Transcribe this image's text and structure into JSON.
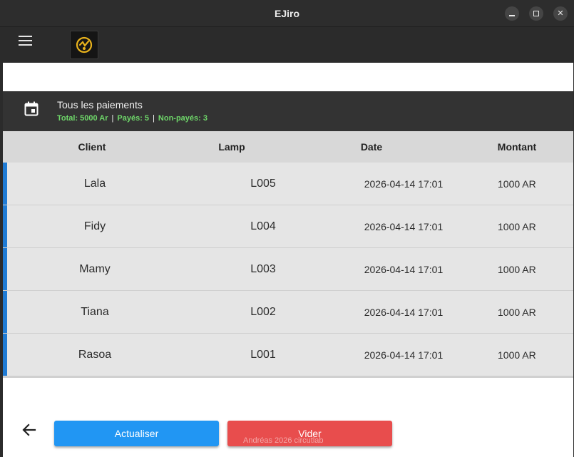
{
  "window": {
    "title": "EJiro"
  },
  "summary": {
    "title": "Tous les paiements",
    "total": "Total: 5000 Ar",
    "paid": "Payés: 5",
    "unpaid": "Non-payés: 3",
    "separator": "|",
    "stats_color": "#6fd86a"
  },
  "table": {
    "headers": [
      "Client",
      "Lamp",
      "Date",
      "Montant"
    ],
    "rows": [
      {
        "client": "Lala",
        "lamp": "L005",
        "date": "2026-04-14 17:01",
        "amount": "1000 AR"
      },
      {
        "client": "Fidy",
        "lamp": "L004",
        "date": "2026-04-14 17:01",
        "amount": "1000 AR"
      },
      {
        "client": "Mamy",
        "lamp": "L003",
        "date": "2026-04-14 17:01",
        "amount": "1000 AR"
      },
      {
        "client": "Tiana",
        "lamp": "L002",
        "date": "2026-04-14 17:01",
        "amount": "1000 AR"
      },
      {
        "client": "Rasoa",
        "lamp": "L001",
        "date": "2026-04-14 17:01",
        "amount": "1000 AR"
      }
    ],
    "accent": "#1f7bd4"
  },
  "footer": {
    "refresh_label": "Actualiser",
    "clear_label": "Vider",
    "watermark": "Andréas 2026 circutlab",
    "refresh_color": "#2196f3",
    "clear_color": "#e84d4d"
  },
  "icons": {
    "menu": "hamburger-menu-icon",
    "logo": "app-logo",
    "calendar": "calendar-icon",
    "back": "arrow-left-icon",
    "minimize": "minimize-icon",
    "maximize": "maximize-icon",
    "close": "close-icon"
  }
}
